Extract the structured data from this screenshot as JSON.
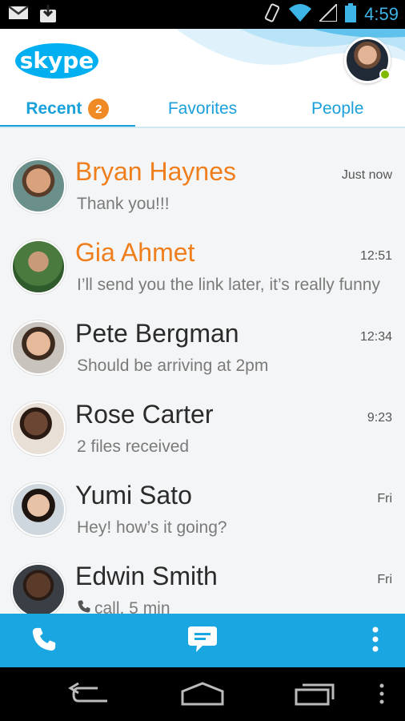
{
  "status_bar": {
    "time": "4:59",
    "icons": [
      "gmail-icon",
      "download-icon",
      "vibrate-icon",
      "wifi-icon",
      "signal-icon",
      "battery-icon"
    ]
  },
  "app": {
    "logo_text": "skype",
    "brand_color": "#1aa1dc",
    "unread_color": "#ef7e1d",
    "presence": "online"
  },
  "tabs": [
    {
      "label": "Recent",
      "badge": "2",
      "active": true
    },
    {
      "label": "Favorites",
      "active": false
    },
    {
      "label": "People",
      "active": false
    }
  ],
  "conversations": [
    {
      "name": "Bryan Haynes",
      "time": "Just now",
      "message": "Thank you!!!",
      "unread": true
    },
    {
      "name": "Gia Ahmet",
      "time": "12:51",
      "message": "I’ll send you the link later, it’s really funny",
      "unread": true
    },
    {
      "name": "Pete Bergman",
      "time": "12:34",
      "message": "Should be arriving at 2pm",
      "unread": false
    },
    {
      "name": "Rose Carter",
      "time": "9:23",
      "message": "2 files received",
      "unread": false
    },
    {
      "name": "Yumi Sato",
      "time": "Fri",
      "message": "Hey! how’s it going?",
      "unread": false
    },
    {
      "name": "Edwin Smith",
      "time": "Fri",
      "message": "call, 5 min",
      "unread": false,
      "icon": "phone-icon"
    }
  ],
  "action_bar": {
    "icons": [
      "phone-icon",
      "chat-icon",
      "overflow-menu-icon"
    ]
  },
  "nav_bar": {
    "icons": [
      "back-icon",
      "home-icon",
      "recents-icon",
      "menu-icon"
    ]
  }
}
